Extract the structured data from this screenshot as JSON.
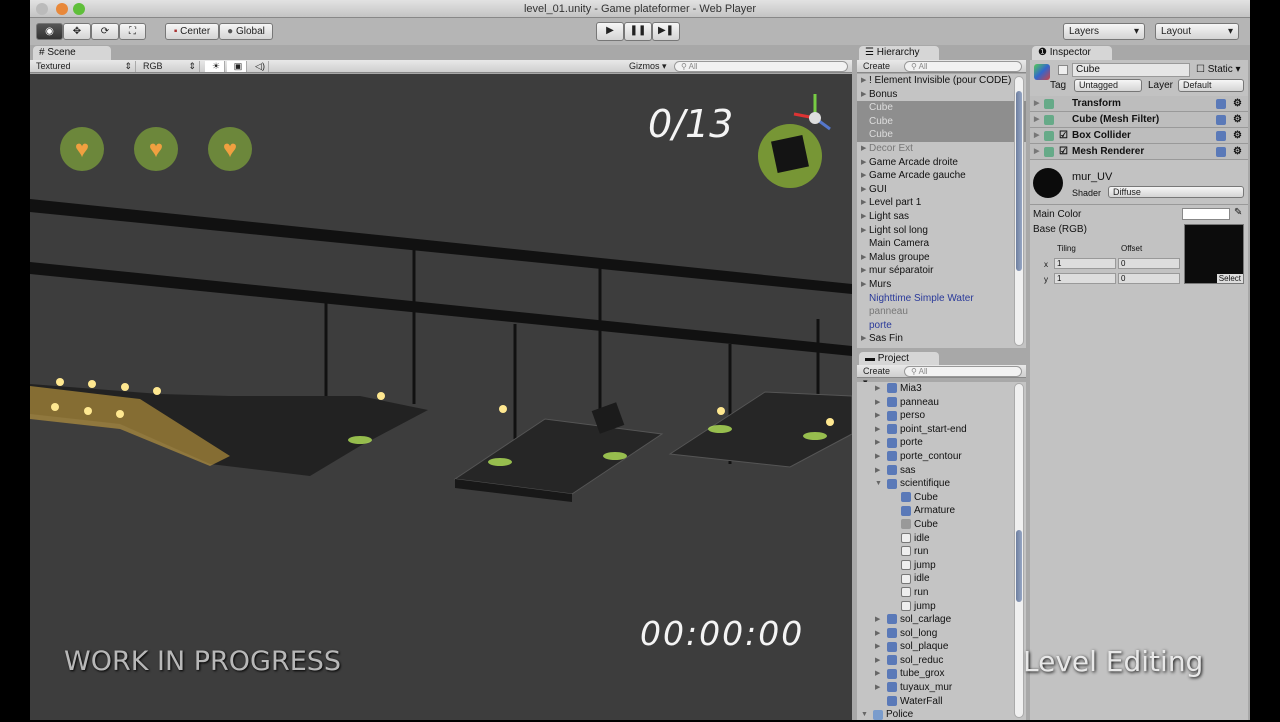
{
  "window": {
    "title": "level_01.unity - Game plateformer - Web Player"
  },
  "toolbar": {
    "tools": [
      "view",
      "move",
      "rotate",
      "scale"
    ],
    "center": "Center",
    "global": "Global",
    "play": "▶",
    "pause": "❚❚",
    "step": "▶❚",
    "layers": "Layers",
    "layout": "Layout"
  },
  "scene": {
    "tab": "Scene",
    "render_mode": "Textured",
    "channel": "RGB",
    "gizmos": "Gizmos",
    "search": "All"
  },
  "hud": {
    "score": "0/13",
    "timer": "00:00:00",
    "wip": "WORK IN PROGRESS",
    "caption": "Level Editing",
    "hearts": 3
  },
  "hierarchy": {
    "tab": "Hierarchy",
    "create": "Create",
    "search": "All",
    "items": [
      {
        "label": "! Element Invisible (pour CODE)",
        "arrow": true,
        "style": ""
      },
      {
        "label": "Bonus",
        "arrow": true,
        "style": ""
      },
      {
        "label": "Cube",
        "arrow": false,
        "style": "selrow"
      },
      {
        "label": "Cube",
        "arrow": false,
        "style": "selrow"
      },
      {
        "label": "Cube",
        "arrow": false,
        "style": "selrow"
      },
      {
        "label": "Decor Ext",
        "arrow": true,
        "style": "grey"
      },
      {
        "label": "Game Arcade droite",
        "arrow": true,
        "style": ""
      },
      {
        "label": "Game Arcade gauche",
        "arrow": true,
        "style": ""
      },
      {
        "label": "GUI",
        "arrow": true,
        "style": ""
      },
      {
        "label": "Level part 1",
        "arrow": true,
        "style": ""
      },
      {
        "label": "Light sas",
        "arrow": true,
        "style": ""
      },
      {
        "label": "Light sol long",
        "arrow": true,
        "style": ""
      },
      {
        "label": "Main Camera",
        "arrow": false,
        "style": ""
      },
      {
        "label": "Malus groupe",
        "arrow": true,
        "style": ""
      },
      {
        "label": "mur séparatoir",
        "arrow": true,
        "style": ""
      },
      {
        "label": "Murs",
        "arrow": true,
        "style": ""
      },
      {
        "label": "Nighttime Simple Water",
        "arrow": false,
        "style": "blue"
      },
      {
        "label": "panneau",
        "arrow": false,
        "style": "grey"
      },
      {
        "label": "porte",
        "arrow": false,
        "style": "blue"
      },
      {
        "label": "Sas Fin",
        "arrow": true,
        "style": ""
      }
    ]
  },
  "project": {
    "tab": "Project",
    "create": "Create",
    "search": "All",
    "items": [
      {
        "label": "Mia3",
        "level": 1,
        "arrow": "▶",
        "icon": "prefab"
      },
      {
        "label": "panneau",
        "level": 1,
        "arrow": "▶",
        "icon": "prefab"
      },
      {
        "label": "perso",
        "level": 1,
        "arrow": "▶",
        "icon": "prefab"
      },
      {
        "label": "point_start-end",
        "level": 1,
        "arrow": "▶",
        "icon": "prefab"
      },
      {
        "label": "porte",
        "level": 1,
        "arrow": "▶",
        "icon": "prefab"
      },
      {
        "label": "porte_contour",
        "level": 1,
        "arrow": "▶",
        "icon": "prefab"
      },
      {
        "label": "sas",
        "level": 1,
        "arrow": "▶",
        "icon": "prefab"
      },
      {
        "label": "scientifique",
        "level": 1,
        "arrow": "▼",
        "icon": "prefab"
      },
      {
        "label": "Cube",
        "level": 2,
        "arrow": "",
        "icon": "prefab"
      },
      {
        "label": "Armature",
        "level": 2,
        "arrow": "",
        "icon": "prefab"
      },
      {
        "label": "Cube",
        "level": 2,
        "arrow": "",
        "icon": "mesh"
      },
      {
        "label": "idle",
        "level": 2,
        "arrow": "",
        "icon": "anim"
      },
      {
        "label": "run",
        "level": 2,
        "arrow": "",
        "icon": "anim"
      },
      {
        "label": "jump",
        "level": 2,
        "arrow": "",
        "icon": "anim"
      },
      {
        "label": "idle",
        "level": 2,
        "arrow": "",
        "icon": "anim"
      },
      {
        "label": "run",
        "level": 2,
        "arrow": "",
        "icon": "anim"
      },
      {
        "label": "jump",
        "level": 2,
        "arrow": "",
        "icon": "anim"
      },
      {
        "label": "sol_carlage",
        "level": 1,
        "arrow": "▶",
        "icon": "prefab"
      },
      {
        "label": "sol_long",
        "level": 1,
        "arrow": "▶",
        "icon": "prefab"
      },
      {
        "label": "sol_plaque",
        "level": 1,
        "arrow": "▶",
        "icon": "prefab"
      },
      {
        "label": "sol_reduc",
        "level": 1,
        "arrow": "▶",
        "icon": "prefab"
      },
      {
        "label": "tube_grox",
        "level": 1,
        "arrow": "▶",
        "icon": "prefab"
      },
      {
        "label": "tuyaux_mur",
        "level": 1,
        "arrow": "▶",
        "icon": "prefab"
      },
      {
        "label": "WaterFall",
        "level": 1,
        "arrow": "",
        "icon": "prefab"
      },
      {
        "label": "Police",
        "level": 0,
        "arrow": "▼",
        "icon": "folder"
      }
    ]
  },
  "inspector": {
    "tab": "Inspector",
    "name": "Cube",
    "static": "Static",
    "tag_label": "Tag",
    "tag": "Untagged",
    "layer_label": "Layer",
    "layer": "Default",
    "components": [
      {
        "label": "Transform",
        "check": false
      },
      {
        "label": "Cube (Mesh Filter)",
        "check": false
      },
      {
        "label": "Box Collider",
        "check": true
      },
      {
        "label": "Mesh Renderer",
        "check": true
      }
    ],
    "material": {
      "name": "mur_UV",
      "shader_label": "Shader",
      "shader": "Diffuse",
      "main_color": "Main Color",
      "base": "Base (RGB)",
      "tiling": "Tiling",
      "offset": "Offset",
      "x_label": "x",
      "y_label": "y",
      "tiling_x": "1",
      "tiling_y": "1",
      "offset_x": "0",
      "offset_y": "0",
      "select": "Select"
    }
  }
}
